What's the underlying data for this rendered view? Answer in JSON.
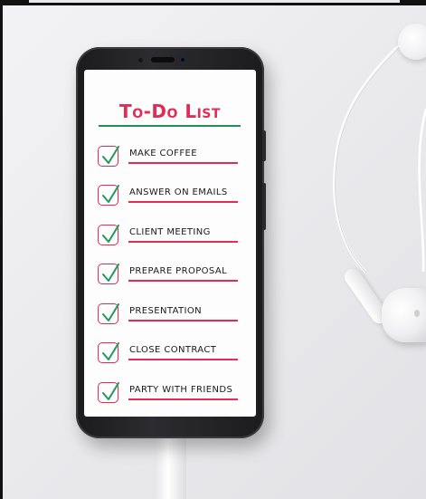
{
  "screen": {
    "title": "To-Do List",
    "accent_color": "#e32b55",
    "rule_color": "#1f8f55",
    "check_color": "#1f9a5a",
    "items": [
      {
        "label": "Make coffee",
        "checked": true
      },
      {
        "label": "Answer on emails",
        "checked": true
      },
      {
        "label": "Client meeting",
        "checked": true
      },
      {
        "label": "Prepare proposal",
        "checked": true
      },
      {
        "label": "Presentation",
        "checked": true
      },
      {
        "label": "Close contract",
        "checked": true
      },
      {
        "label": "Party with friends",
        "checked": true
      }
    ]
  },
  "props": {
    "device": "smartphone",
    "accessories": [
      "earphones",
      "usb-cable"
    ]
  }
}
